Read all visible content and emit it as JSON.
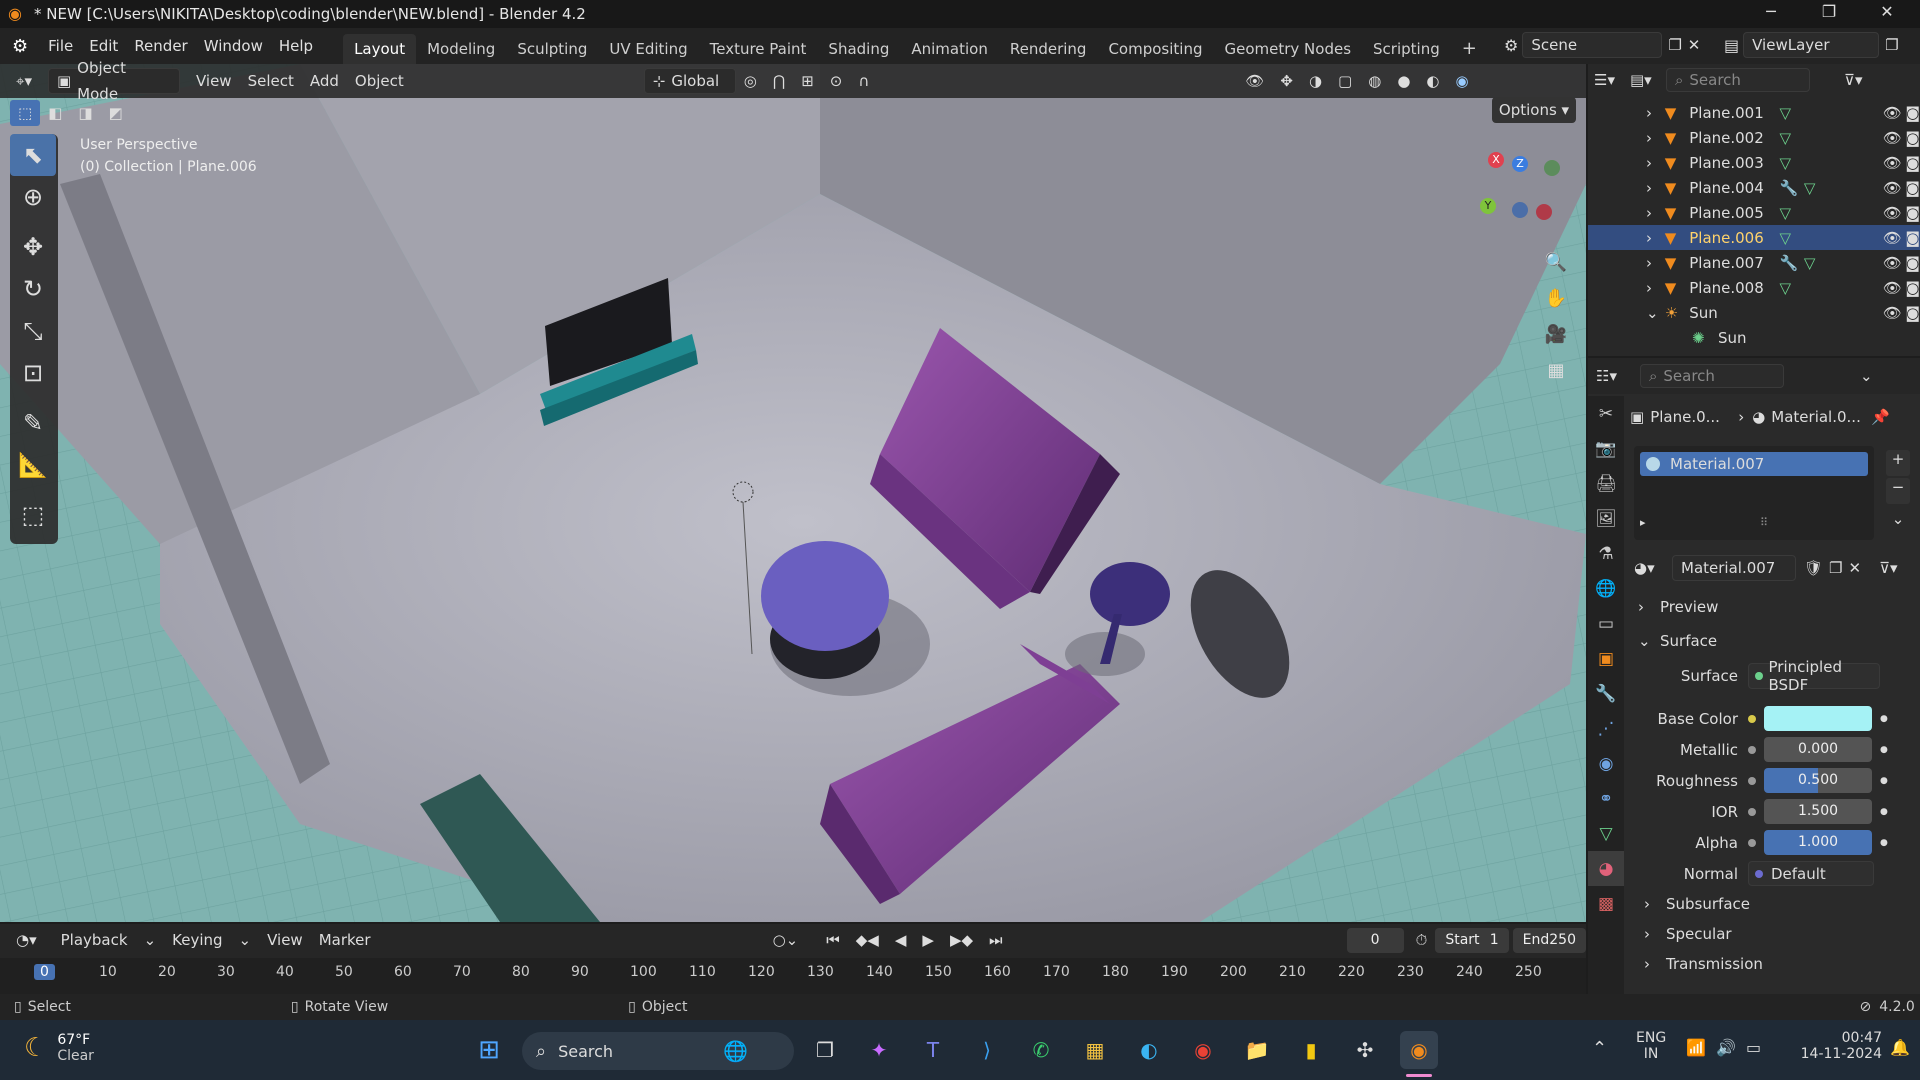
{
  "window": {
    "title": "* NEW [C:\\Users\\NIKITA\\Desktop\\coding\\blender\\NEW.blend] - Blender 4.2"
  },
  "menus": [
    "File",
    "Edit",
    "Render",
    "Window",
    "Help"
  ],
  "workspaces": [
    "Layout",
    "Modeling",
    "Sculpting",
    "UV Editing",
    "Texture Paint",
    "Shading",
    "Animation",
    "Rendering",
    "Compositing",
    "Geometry Nodes",
    "Scripting"
  ],
  "scene": {
    "name": "Scene",
    "view_layer": "ViewLayer"
  },
  "viewport_header": {
    "mode": "Object Mode",
    "menus": [
      "View",
      "Select",
      "Add",
      "Object"
    ],
    "transform": "Global",
    "options": "Options"
  },
  "viewport_info": {
    "line1": "User Perspective",
    "line2": "(0) Collection | Plane.006"
  },
  "gizmo": {
    "x": "X",
    "y": "Y",
    "z": "Z"
  },
  "outliner": {
    "search_placeholder": "Search",
    "items": [
      {
        "name": "Plane.001",
        "selected": false,
        "modifier": false
      },
      {
        "name": "Plane.002",
        "selected": false,
        "modifier": false
      },
      {
        "name": "Plane.003",
        "selected": false,
        "modifier": false
      },
      {
        "name": "Plane.004",
        "selected": false,
        "modifier": true
      },
      {
        "name": "Plane.005",
        "selected": false,
        "modifier": false
      },
      {
        "name": "Plane.006",
        "selected": true,
        "modifier": false
      },
      {
        "name": "Plane.007",
        "selected": false,
        "modifier": true
      },
      {
        "name": "Plane.008",
        "selected": false,
        "modifier": false
      }
    ],
    "sun": {
      "name": "Sun",
      "child": "Sun"
    }
  },
  "properties": {
    "search_placeholder": "Search",
    "breadcrumb_object": "Plane.0...",
    "breadcrumb_material": "Material.0...",
    "slot": "Material.007",
    "material_name": "Material.007",
    "panels": {
      "preview": "Preview",
      "surface": "Surface",
      "subsurface": "Subsurface",
      "specular": "Specular",
      "transmission": "Transmission"
    },
    "surface_label": "Surface",
    "surface_shader": "Principled BSDF",
    "rows": [
      {
        "label": "Base Color",
        "value": "",
        "color": "#a5f2f5"
      },
      {
        "label": "Metallic",
        "value": "0.000"
      },
      {
        "label": "Roughness",
        "value": "0.500"
      },
      {
        "label": "IOR",
        "value": "1.500"
      },
      {
        "label": "Alpha",
        "value": "1.000"
      },
      {
        "label": "Normal",
        "value": "Default"
      }
    ]
  },
  "timeline": {
    "menus": [
      "Playback",
      "Keying",
      "View",
      "Marker"
    ],
    "current_frame": "0",
    "start_label": "Start",
    "start": "1",
    "end_label": "End",
    "end": "250",
    "ticks": [
      "0",
      "10",
      "20",
      "30",
      "40",
      "50",
      "60",
      "70",
      "80",
      "90",
      "100",
      "110",
      "120",
      "130",
      "140",
      "150",
      "160",
      "170",
      "180",
      "190",
      "200",
      "210",
      "220",
      "230",
      "240",
      "250"
    ]
  },
  "statusbar": {
    "select": "Select",
    "rotate": "Rotate View",
    "object": "Object",
    "version": "4.2.0"
  },
  "taskbar": {
    "weather_temp": "67°F",
    "weather_desc": "Clear",
    "search": "Search",
    "lang1": "ENG",
    "lang2": "IN",
    "time": "00:47",
    "date": "14-11-2024"
  },
  "colors": {
    "accent": "#4772b3",
    "selected_row": "#334d80",
    "sofa": "#7b3e8e",
    "table": "#6a5fc0",
    "floor": "#a8a8b4",
    "grid": "#7fb3b0"
  }
}
